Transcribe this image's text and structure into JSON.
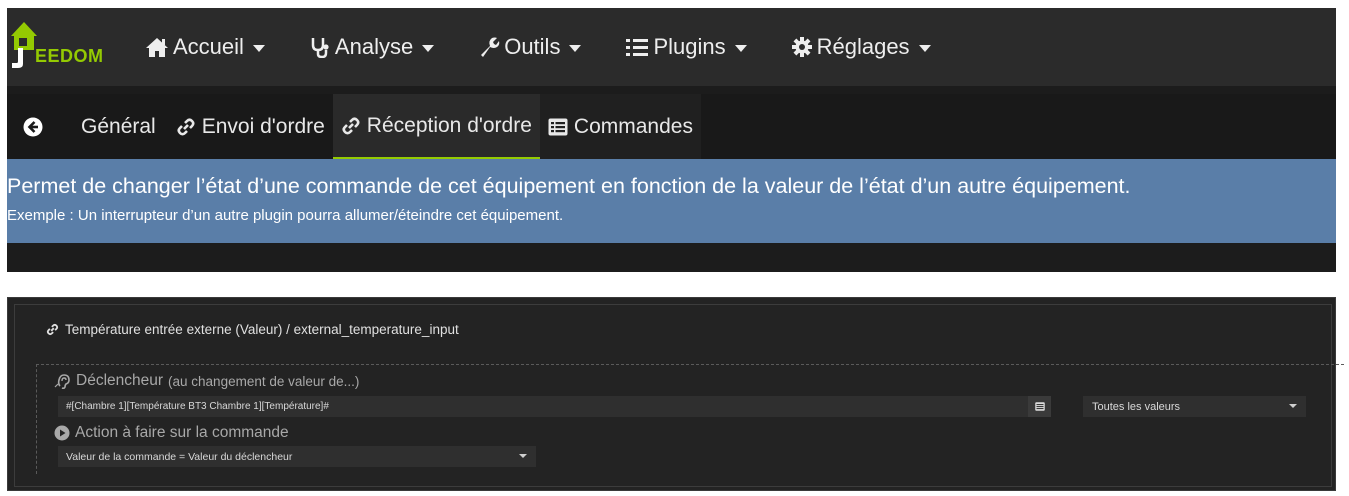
{
  "app": {
    "logo_text": "EEDOM",
    "logo_icon": "jeedom-house-icon"
  },
  "navbar": {
    "items": [
      {
        "label": "Accueil",
        "icon": "home-icon"
      },
      {
        "label": "Analyse",
        "icon": "stethoscope-icon"
      },
      {
        "label": "Outils",
        "icon": "wrench-icon"
      },
      {
        "label": "Plugins",
        "icon": "list-icon"
      },
      {
        "label": "Réglages",
        "icon": "gear-icon"
      }
    ]
  },
  "tabs": {
    "back_icon": "arrow-circle-left-icon",
    "items": [
      {
        "label": "Général",
        "icon": ""
      },
      {
        "label": "Envoi d'ordre",
        "icon": "link-icon"
      },
      {
        "label": "Réception d'ordre",
        "icon": "link-icon",
        "active": true
      },
      {
        "label": "Commandes",
        "icon": "list-alt-icon"
      }
    ]
  },
  "info": {
    "line1": "Permet de changer l’état d’une commande de cet équipement en fonction de la valeur de l’état d’un autre équipement.",
    "line2": "Exemple : Un interrupteur d’un autre plugin pourra allumer/éteindre cet équipement."
  },
  "command": {
    "title": "Température entrée externe (Valeur) / external_temperature_input",
    "trigger": {
      "label": "Déclencheur",
      "sublabel": "(au changement de valeur de...)",
      "value": "#[Chambre 1][Température BT3 Chambre 1][Température]#",
      "values_option": "Toutes les valeurs"
    },
    "action": {
      "label": "Action à faire sur la commande",
      "selected": "Valeur de la commande = Valeur du déclencheur"
    }
  },
  "colors": {
    "accent": "#94ca02",
    "info_bg": "#5a7ea8",
    "navbar_bg": "#2b2b2b",
    "panel_bg": "#232323"
  }
}
